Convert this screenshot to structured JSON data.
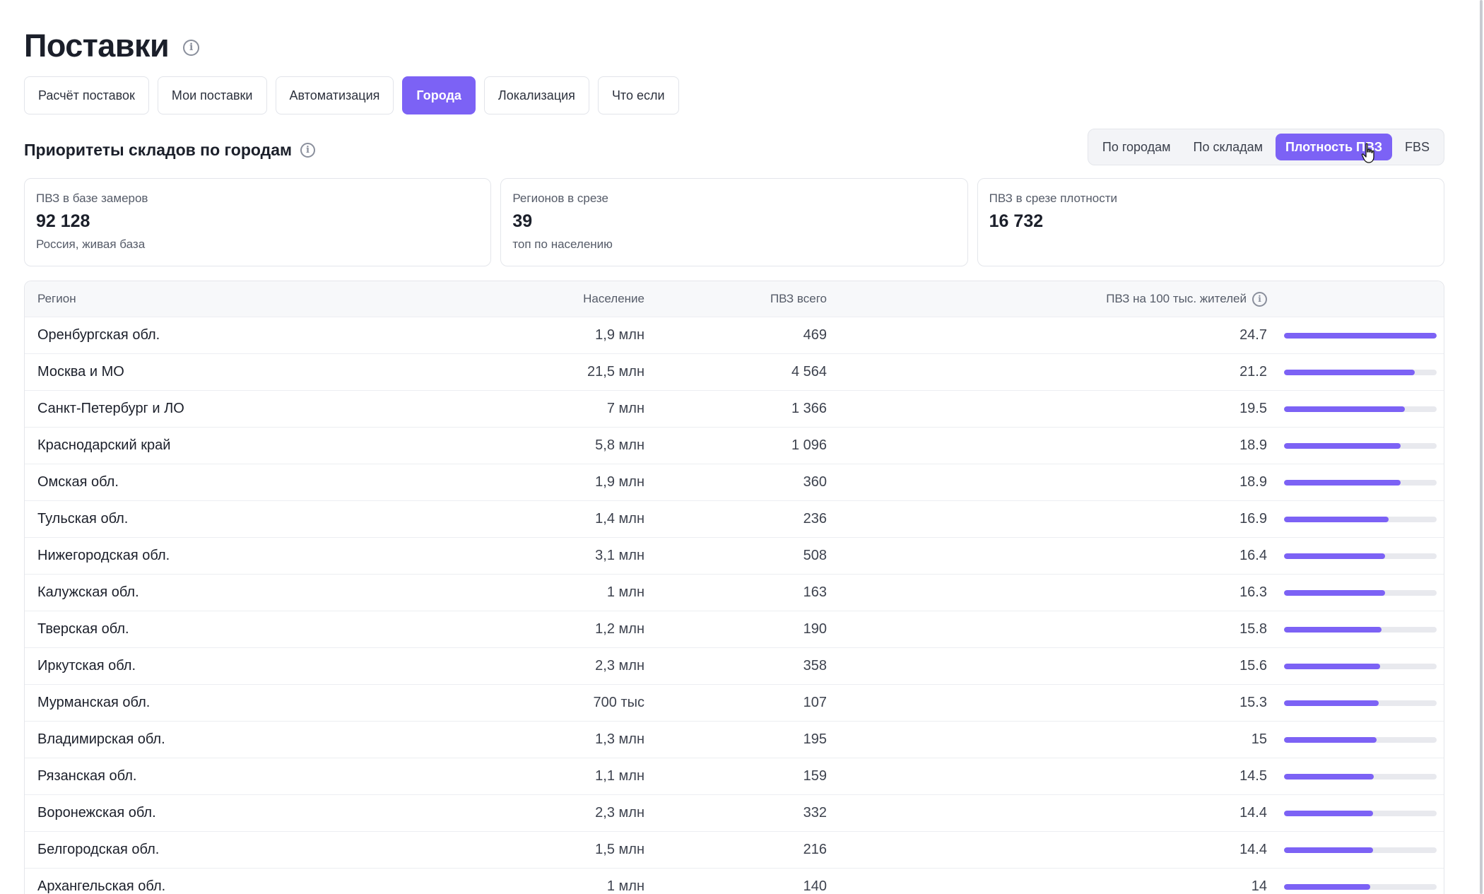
{
  "header": {
    "title": "Поставки"
  },
  "tabs": [
    {
      "label": "Расчёт поставок",
      "active": false
    },
    {
      "label": "Мои поставки",
      "active": false
    },
    {
      "label": "Автоматизация",
      "active": false
    },
    {
      "label": "Города",
      "active": true
    },
    {
      "label": "Локализация",
      "active": false
    },
    {
      "label": "Что если",
      "active": false
    }
  ],
  "section": {
    "title": "Приоритеты складов по городам",
    "views": [
      {
        "label": "По городам",
        "active": false
      },
      {
        "label": "По складам",
        "active": false
      },
      {
        "label": "Плотность ПВЗ",
        "active": true
      },
      {
        "label": "FBS",
        "active": false
      }
    ]
  },
  "cards": [
    {
      "label": "ПВЗ в базе замеров",
      "value": "92 128",
      "note": "Россия, живая база"
    },
    {
      "label": "Регионов в срезе",
      "value": "39",
      "note": "топ по населению"
    },
    {
      "label": "ПВЗ в срезе плотности",
      "value": "16 732",
      "note": ""
    }
  ],
  "table": {
    "columns": {
      "region": "Регион",
      "population": "Население",
      "pvz_total": "ПВЗ всего",
      "density": "ПВЗ на 100 тыс. жителей"
    },
    "max_density": 24.7,
    "rows": [
      {
        "region": "Оренбургская обл.",
        "population": "1,9 млн",
        "pvz": "469",
        "density": "24.7"
      },
      {
        "region": "Москва и МО",
        "population": "21,5 млн",
        "pvz": "4 564",
        "density": "21.2"
      },
      {
        "region": "Санкт-Петербург и ЛО",
        "population": "7 млн",
        "pvz": "1 366",
        "density": "19.5"
      },
      {
        "region": "Краснодарский край",
        "population": "5,8 млн",
        "pvz": "1 096",
        "density": "18.9"
      },
      {
        "region": "Омская обл.",
        "population": "1,9 млн",
        "pvz": "360",
        "density": "18.9"
      },
      {
        "region": "Тульская обл.",
        "population": "1,4 млн",
        "pvz": "236",
        "density": "16.9"
      },
      {
        "region": "Нижегородская обл.",
        "population": "3,1 млн",
        "pvz": "508",
        "density": "16.4"
      },
      {
        "region": "Калужская обл.",
        "population": "1 млн",
        "pvz": "163",
        "density": "16.3"
      },
      {
        "region": "Тверская обл.",
        "population": "1,2 млн",
        "pvz": "190",
        "density": "15.8"
      },
      {
        "region": "Иркутская обл.",
        "population": "2,3 млн",
        "pvz": "358",
        "density": "15.6"
      },
      {
        "region": "Мурманская обл.",
        "population": "700 тыс",
        "pvz": "107",
        "density": "15.3"
      },
      {
        "region": "Владимирская обл.",
        "population": "1,3 млн",
        "pvz": "195",
        "density": "15"
      },
      {
        "region": "Рязанская обл.",
        "population": "1,1 млн",
        "pvz": "159",
        "density": "14.5"
      },
      {
        "region": "Воронежская обл.",
        "population": "2,3 млн",
        "pvz": "332",
        "density": "14.4"
      },
      {
        "region": "Белгородская обл.",
        "population": "1,5 млн",
        "pvz": "216",
        "density": "14.4"
      },
      {
        "region": "Архангельская обл.",
        "population": "1 млн",
        "pvz": "140",
        "density": "14"
      }
    ]
  },
  "colors": {
    "accent": "#7c62f5",
    "bar_track": "#e8e9ee",
    "border": "#e4e6eb"
  },
  "icons": {
    "info": "info-icon",
    "cursor": "hand-pointer-icon"
  }
}
